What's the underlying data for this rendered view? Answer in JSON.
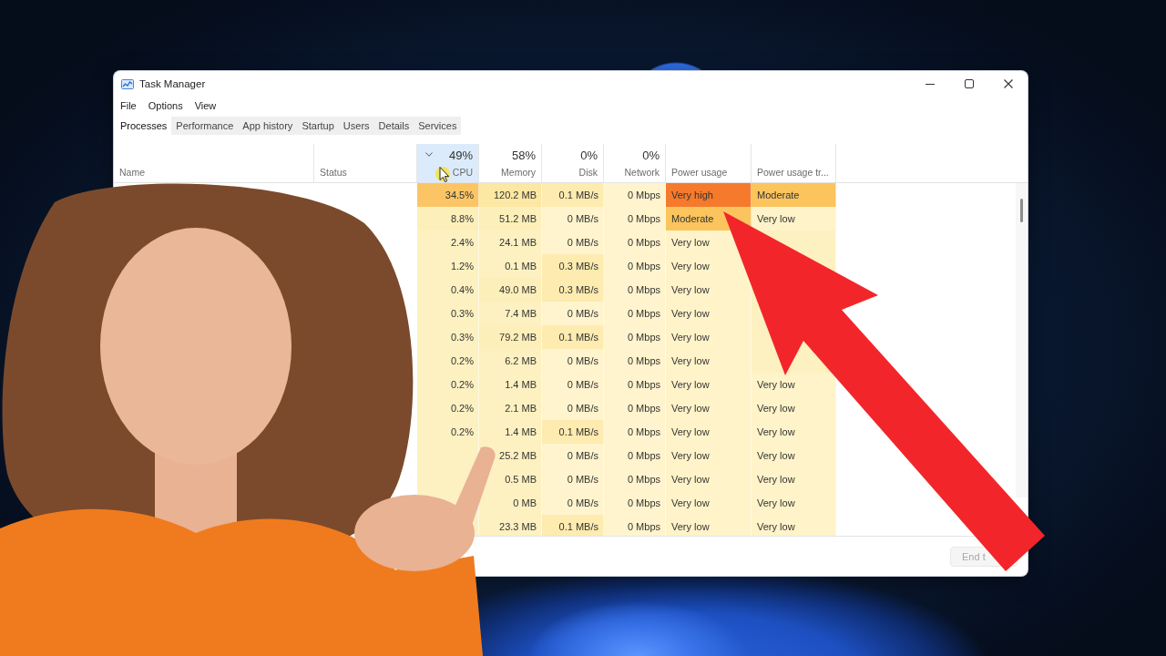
{
  "window": {
    "title": "Task Manager"
  },
  "menu": [
    "File",
    "Options",
    "View"
  ],
  "tabs": [
    {
      "label": "Processes",
      "selected": true
    },
    {
      "label": "Performance",
      "selected": false
    },
    {
      "label": "App history",
      "selected": false
    },
    {
      "label": "Startup",
      "selected": false
    },
    {
      "label": "Users",
      "selected": false
    },
    {
      "label": "Details",
      "selected": false
    },
    {
      "label": "Services",
      "selected": false
    }
  ],
  "table": {
    "columns": [
      {
        "label": "Name",
        "sorted": false
      },
      {
        "label": "Status",
        "sorted": false
      },
      {
        "label": "CPU",
        "percent": "49%",
        "sorted": true
      },
      {
        "label": "Memory",
        "percent": "58%",
        "sorted": false
      },
      {
        "label": "Disk",
        "percent": "0%",
        "sorted": false
      },
      {
        "label": "Network",
        "percent": "0%",
        "sorted": false
      },
      {
        "label": "Power usage",
        "sorted": false
      },
      {
        "label": "Power usage tr...",
        "sorted": false
      }
    ],
    "rows": [
      {
        "cells": [
          null,
          null,
          {
            "text": "34.5%",
            "color": "#fbc566"
          },
          {
            "text": "120.2 MB",
            "color": "#fce7a3"
          },
          {
            "text": "0.1 MB/s",
            "color": "#fdebb0"
          },
          {
            "text": "0 Mbps",
            "color": "#fff4cd"
          },
          {
            "text": "Very high",
            "color": "#f57a2c"
          },
          {
            "text": "Moderate",
            "color": "#fcc45d"
          }
        ]
      },
      {
        "cells": [
          null,
          null,
          {
            "text": "8.8%",
            "color": "#fdefb9"
          },
          {
            "text": "51.2 MB",
            "color": "#fdefb9"
          },
          {
            "text": "0 MB/s",
            "color": "#fff4cd"
          },
          {
            "text": "0 Mbps",
            "color": "#fff4cd"
          },
          {
            "text": "Moderate",
            "color": "#fcc45d"
          },
          {
            "text": "Very low",
            "color": "#fff3c9"
          }
        ]
      },
      {
        "cells": [
          null,
          null,
          {
            "text": "2.4%",
            "color": "#fdf1c1"
          },
          {
            "text": "24.1 MB",
            "color": "#fdf1c1"
          },
          {
            "text": "0 MB/s",
            "color": "#fff4cd"
          },
          {
            "text": "0 Mbps",
            "color": "#fff4cd"
          },
          {
            "text": "Very low",
            "color": "#fff3c9"
          },
          null
        ]
      },
      {
        "cells": [
          null,
          null,
          {
            "text": "1.2%",
            "color": "#fdf1c1"
          },
          {
            "text": "0.1 MB",
            "color": "#fdf1c1"
          },
          {
            "text": "0.3 MB/s",
            "color": "#fdebb0"
          },
          {
            "text": "0 Mbps",
            "color": "#fff4cd"
          },
          {
            "text": "Very low",
            "color": "#fff3c9"
          },
          null
        ]
      },
      {
        "cells": [
          null,
          null,
          {
            "text": "0.4%",
            "color": "#fdf1c1"
          },
          {
            "text": "49.0 MB",
            "color": "#fdefb9"
          },
          {
            "text": "0.3 MB/s",
            "color": "#fdebb0"
          },
          {
            "text": "0 Mbps",
            "color": "#fff4cd"
          },
          {
            "text": "Very low",
            "color": "#fff3c9"
          },
          null
        ]
      },
      {
        "cells": [
          null,
          null,
          {
            "text": "0.3%",
            "color": "#fdf1c1"
          },
          {
            "text": "7.4 MB",
            "color": "#fdf1c1"
          },
          {
            "text": "0 MB/s",
            "color": "#fff4cd"
          },
          {
            "text": "0 Mbps",
            "color": "#fff4cd"
          },
          {
            "text": "Very low",
            "color": "#fff3c9"
          },
          null
        ]
      },
      {
        "cells": [
          null,
          null,
          {
            "text": "0.3%",
            "color": "#fdf1c1"
          },
          {
            "text": "79.2 MB",
            "color": "#fdefb9"
          },
          {
            "text": "0.1 MB/s",
            "color": "#fdebb0"
          },
          {
            "text": "0 Mbps",
            "color": "#fff4cd"
          },
          {
            "text": "Very low",
            "color": "#fff3c9"
          },
          null
        ]
      },
      {
        "cells": [
          null,
          null,
          {
            "text": "0.2%",
            "color": "#fdf1c1"
          },
          {
            "text": "6.2 MB",
            "color": "#fdf1c1"
          },
          {
            "text": "0 MB/s",
            "color": "#fff4cd"
          },
          {
            "text": "0 Mbps",
            "color": "#fff4cd"
          },
          {
            "text": "Very low",
            "color": "#fff3c9"
          },
          null
        ]
      },
      {
        "cells": [
          null,
          null,
          {
            "text": "0.2%",
            "color": "#fdf1c1"
          },
          {
            "text": "1.4 MB",
            "color": "#fdf1c1"
          },
          {
            "text": "0 MB/s",
            "color": "#fff4cd"
          },
          {
            "text": "0 Mbps",
            "color": "#fff4cd"
          },
          {
            "text": "Very low",
            "color": "#fff3c9"
          },
          {
            "text": "Very low",
            "color": "#fff3c9"
          }
        ]
      },
      {
        "cells": [
          null,
          null,
          {
            "text": "0.2%",
            "color": "#fdf1c1"
          },
          {
            "text": "2.1 MB",
            "color": "#fdf1c1"
          },
          {
            "text": "0 MB/s",
            "color": "#fff4cd"
          },
          {
            "text": "0 Mbps",
            "color": "#fff4cd"
          },
          {
            "text": "Very low",
            "color": "#fff3c9"
          },
          {
            "text": "Very low",
            "color": "#fff3c9"
          }
        ]
      },
      {
        "cells": [
          null,
          null,
          {
            "text": "0.2%",
            "color": "#fdf1c1"
          },
          {
            "text": "1.4 MB",
            "color": "#fdf1c1"
          },
          {
            "text": "0.1 MB/s",
            "color": "#fdebb0"
          },
          {
            "text": "0 Mbps",
            "color": "#fff4cd"
          },
          {
            "text": "Very low",
            "color": "#fff3c9"
          },
          {
            "text": "Very low",
            "color": "#fff3c9"
          }
        ]
      },
      {
        "cells": [
          null,
          null,
          null,
          {
            "text": "25.2 MB",
            "color": "#fdf1c1"
          },
          {
            "text": "0 MB/s",
            "color": "#fff4cd"
          },
          {
            "text": "0 Mbps",
            "color": "#fff4cd"
          },
          {
            "text": "Very low",
            "color": "#fff3c9"
          },
          {
            "text": "Very low",
            "color": "#fff3c9"
          }
        ]
      },
      {
        "cells": [
          null,
          null,
          null,
          {
            "text": "0.5 MB",
            "color": "#fdf1c1"
          },
          {
            "text": "0 MB/s",
            "color": "#fff4cd"
          },
          {
            "text": "0 Mbps",
            "color": "#fff4cd"
          },
          {
            "text": "Very low",
            "color": "#fff3c9"
          },
          {
            "text": "Very low",
            "color": "#fff3c9"
          }
        ]
      },
      {
        "cells": [
          null,
          null,
          null,
          {
            "text": "0 MB",
            "color": "#fdf1c1"
          },
          {
            "text": "0 MB/s",
            "color": "#fff4cd"
          },
          {
            "text": "0 Mbps",
            "color": "#fff4cd"
          },
          {
            "text": "Very low",
            "color": "#fff3c9"
          },
          {
            "text": "Very low",
            "color": "#fff3c9"
          }
        ]
      },
      {
        "cells": [
          null,
          null,
          null,
          {
            "text": "23.3 MB",
            "color": "#fdf1c1"
          },
          {
            "text": "0.1 MB/s",
            "color": "#fdebb0"
          },
          {
            "text": "0 Mbps",
            "color": "#fff4cd"
          },
          {
            "text": "Very low",
            "color": "#fff3c9"
          },
          {
            "text": "Very low",
            "color": "#fff3c9"
          }
        ]
      }
    ]
  },
  "footer": {
    "button": {
      "label": "End t",
      "disabled": true
    }
  }
}
